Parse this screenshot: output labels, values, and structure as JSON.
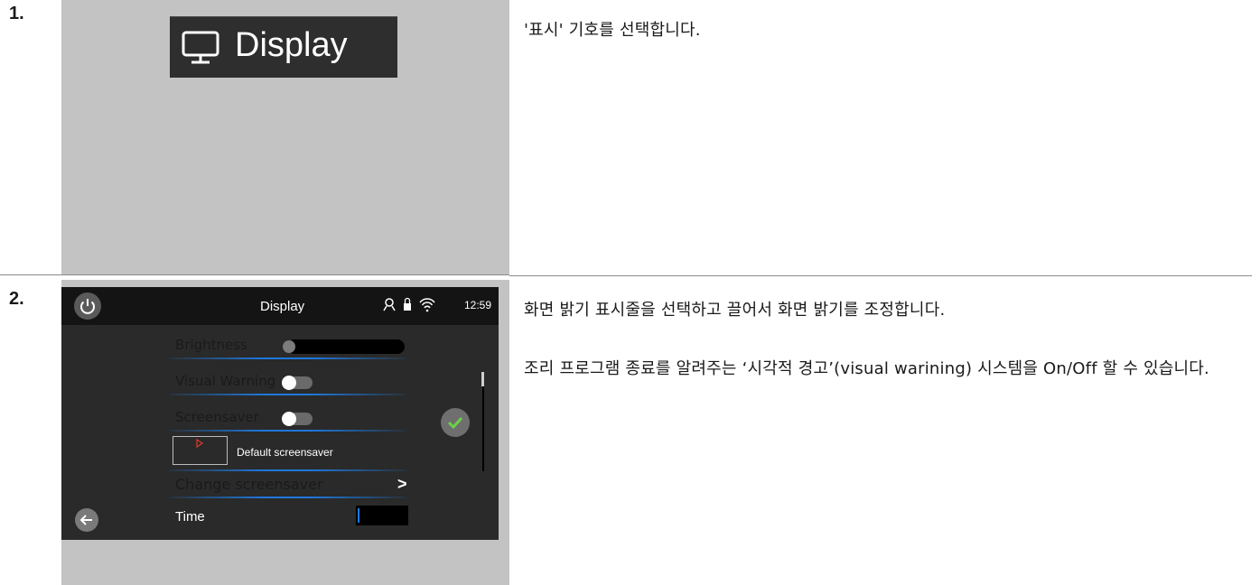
{
  "steps": [
    {
      "number": "1.",
      "icon_label": "Display",
      "icon": "monitor-icon",
      "paragraphs": [
        "'표시' 기호를 선택합니다."
      ]
    },
    {
      "number": "2.",
      "paragraphs": [
        "화면 밝기 표시줄을 선택하고 끌어서 화면 밝기를 조정합니다.",
        "조리 프로그램 종료를 알려주는 ‘시각적 경고’(visual warining) 시스템을 On/Off 할 수 있습니다."
      ],
      "device": {
        "title": "Display",
        "time": "12:59",
        "status_icons": [
          "chef-hat-icon",
          "lock-icon",
          "wifi-icon"
        ],
        "rows": {
          "brightness": "Brightness",
          "visual_warning": "Visual Warning",
          "screensaver": "Screensaver",
          "default_screensaver": "Default screensaver",
          "change_screensaver": "Change screensaver",
          "time": "Time"
        },
        "visual_warning_on": false,
        "screensaver_on": false,
        "brightness_level": 0.0
      }
    }
  ]
}
